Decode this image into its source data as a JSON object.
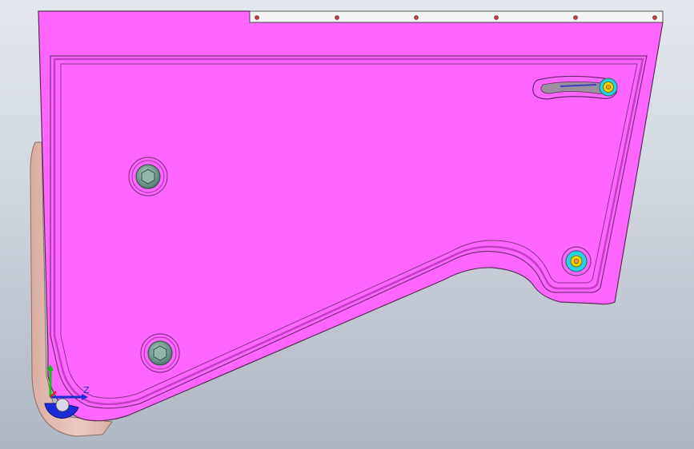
{
  "viewport": {
    "name": "3d-model-viewport",
    "colors": {
      "background_top": "#e3e8ee",
      "background_bottom": "#aeb6c1",
      "plate": "#ff66ff",
      "plate_edge": "#5a2a5a",
      "groove": "#b03ab0",
      "back_part": "#e9c3b8",
      "back_part_edge": "#8a6f66",
      "strip": "#f4f4f4",
      "bolt": "#6f9c8e",
      "cyan_ring": "#2ad0e0",
      "yellow": "#e6d400",
      "axis_y": "#13c013",
      "axis_x": "#1b2bd6",
      "axis_z": "#e21b1b"
    },
    "triad": {
      "x_label": "",
      "y_label": "",
      "z_label": "Z"
    },
    "features": {
      "fasteners": [
        "bolt-upper-left",
        "bolt-lower-left",
        "bushing-right",
        "slot-pin"
      ],
      "strip_holes": 6
    }
  }
}
